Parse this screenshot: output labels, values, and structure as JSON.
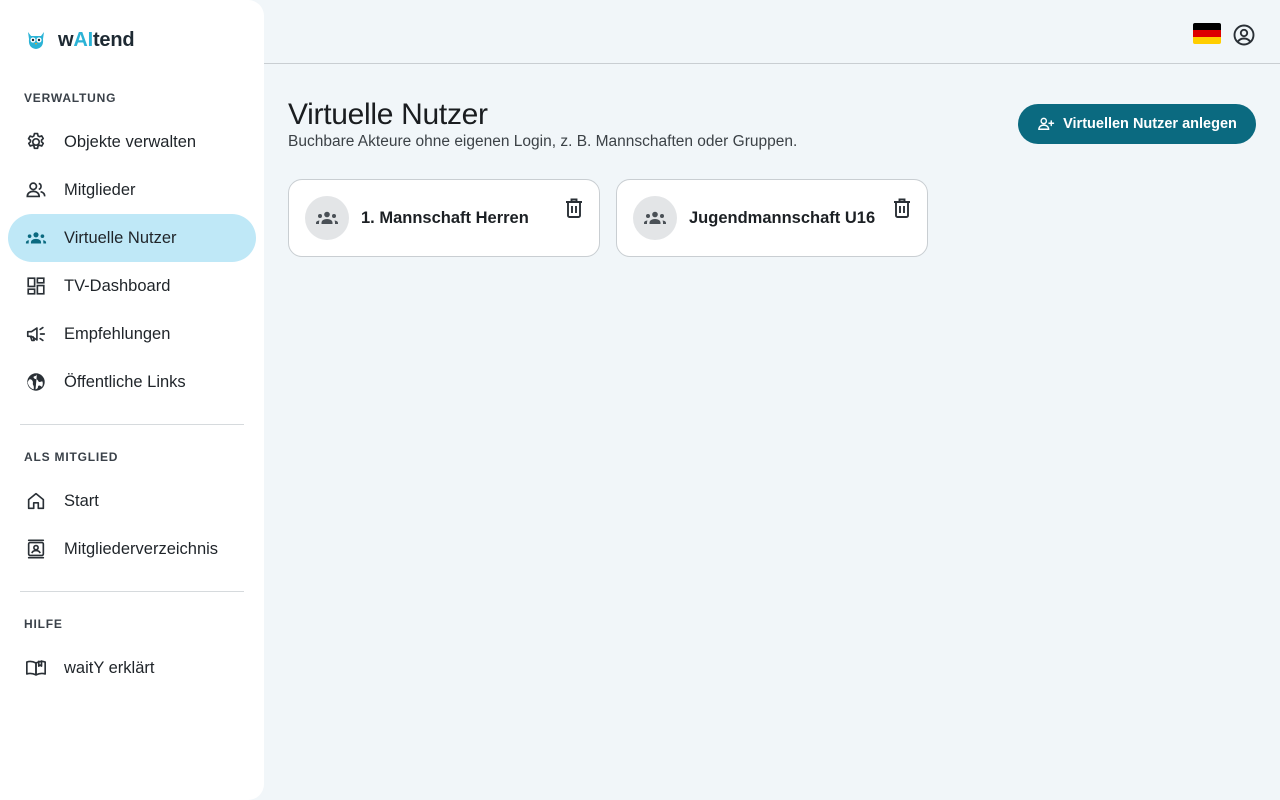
{
  "brand": {
    "name_prefix": "w",
    "name_ai": "AI",
    "name_suffix": "tend"
  },
  "sidebar": {
    "sections": [
      {
        "title": "VERWALTUNG"
      },
      {
        "title": "ALS MITGLIED"
      },
      {
        "title": "HILFE"
      }
    ],
    "items": [
      {
        "label": "Objekte verwalten",
        "icon": "gear-icon"
      },
      {
        "label": "Mitglieder",
        "icon": "people-icon"
      },
      {
        "label": "Virtuelle Nutzer",
        "icon": "groups-icon",
        "active": true
      },
      {
        "label": "TV-Dashboard",
        "icon": "dashboard-icon"
      },
      {
        "label": "Empfehlungen",
        "icon": "campaign-icon"
      },
      {
        "label": "Öffentliche Links",
        "icon": "globe-icon"
      },
      {
        "label": "Start",
        "icon": "home-icon"
      },
      {
        "label": "Mitgliederverzeichnis",
        "icon": "contact-page-icon"
      },
      {
        "label": "waitY erklärt",
        "icon": "book-icon"
      }
    ]
  },
  "topbar": {
    "language": "flag-de-icon",
    "account": "account-circle-icon"
  },
  "main": {
    "title": "Virtuelle Nutzer",
    "subtitle": "Buchbare Akteure ohne eigenen Login, z. B. Mannschaften oder Gruppen.",
    "add_button_label": "Virtuellen Nutzer anlegen",
    "cards": [
      {
        "name": "1. Mannschaft Herren"
      },
      {
        "name": "Jugendmannschaft U16"
      }
    ]
  },
  "colors": {
    "accent": "#0b6a80",
    "active_nav": "#bfe8f7",
    "background": "#f1f6f9",
    "brand_ai": "#2bb3d6"
  }
}
